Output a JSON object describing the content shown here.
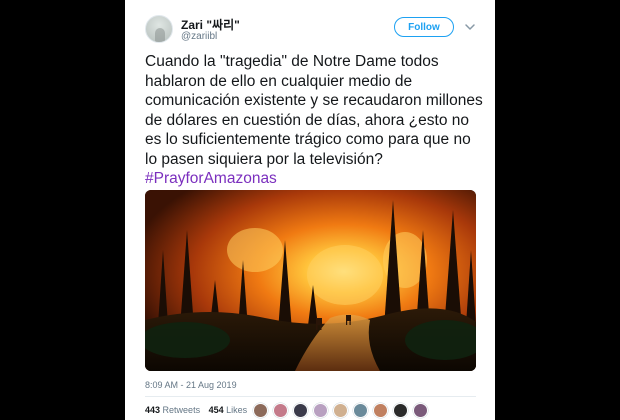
{
  "tweet": {
    "user": {
      "display_name": "Zari \"싸리\"",
      "handle": "@zariibl"
    },
    "follow_label": "Follow",
    "text_plain": "Cuando la \"tragedia\" de Notre Dame todos hablaron de ello en cualquier medio de comunicación existente y se recaudaron millones de dólares en cuestión de días, ahora ¿esto no es lo suficientemente trágico como para que no lo pasen siquiera por la televisión? ",
    "hashtag": "#PrayforAmazonas",
    "timestamp": "8:09 AM - 21 Aug 2019",
    "retweets": {
      "count": "443",
      "label": "Retweets"
    },
    "likes": {
      "count": "454",
      "label": "Likes"
    },
    "liker_avatar_colors": [
      "#8c6a5a",
      "#c47a8a",
      "#3a3a4a",
      "#b8a0c0",
      "#d0b090",
      "#6a8a9a",
      "#c08060",
      "#2a2a2a",
      "#7a5a7a"
    ]
  },
  "colors": {
    "accent": "#1da1f2",
    "hashtag": "#7b2fbe",
    "text": "#14171a",
    "muted": "#657786"
  },
  "media": {
    "description_icon": "forest-fire-photo"
  }
}
